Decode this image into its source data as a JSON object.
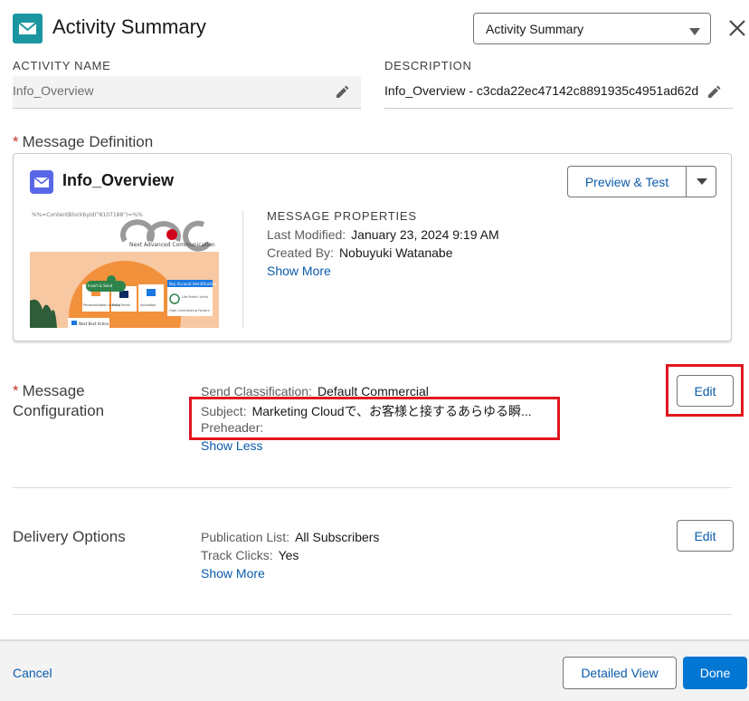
{
  "header": {
    "title": "Activity Summary",
    "view_select": "Activity Summary",
    "icon": "envelope-icon",
    "accent": "#1b96a0"
  },
  "activity": {
    "name_label": "ACTIVITY NAME",
    "name_value": "Info_Overview",
    "description_label": "DESCRIPTION",
    "description_value": "Info_Overview - c3cda22ec47142c8891935c4951ad62d"
  },
  "message_definition": {
    "required_mark": "*",
    "title": "Message Definition",
    "message_name": "Info_Overview",
    "preview_button": "Preview & Test",
    "thumbnail": {
      "code_text": "%%=ContentBlockbyId(\"8107188\")=%%",
      "brand_text": "Next Advanced Communication",
      "pill_text": "Insert & Send",
      "card_right_title": "Key Account Identification",
      "card_right_text": "Life Metric Verify",
      "card_right_sub": "High Contributing Factors",
      "card1": "Personalization Activity",
      "card2": "Send Email",
      "card3": "Activation",
      "bottom_label": "Next Best Action"
    },
    "properties_title": "MESSAGE PROPERTIES",
    "last_modified_label": "Last Modified:",
    "last_modified_value": "January 23, 2024 9:19 AM",
    "created_by_label": "Created By:",
    "created_by_value": "Nobuyuki Watanabe",
    "show_more": "Show More"
  },
  "message_configuration": {
    "required_mark": "*",
    "title_line1": "Message",
    "title_line2": "Configuration",
    "send_classification_label": "Send Classification:",
    "send_classification_value": "Default Commercial",
    "subject_label": "Subject:",
    "subject_value": "Marketing Cloudで、お客様と接するあらゆる瞬...",
    "preheader_label": "Preheader:",
    "preheader_value": "",
    "show_less": "Show Less",
    "edit_button": "Edit",
    "highlight_color": "#e0161e"
  },
  "delivery_options": {
    "title": "Delivery Options",
    "publication_list_label": "Publication List:",
    "publication_list_value": "All Subscribers",
    "track_clicks_label": "Track Clicks:",
    "track_clicks_value": "Yes",
    "show_more": "Show More",
    "edit_button": "Edit"
  },
  "footer": {
    "cancel": "Cancel",
    "detailed_view": "Detailed View",
    "done": "Done",
    "done_color": "#0176d3"
  }
}
